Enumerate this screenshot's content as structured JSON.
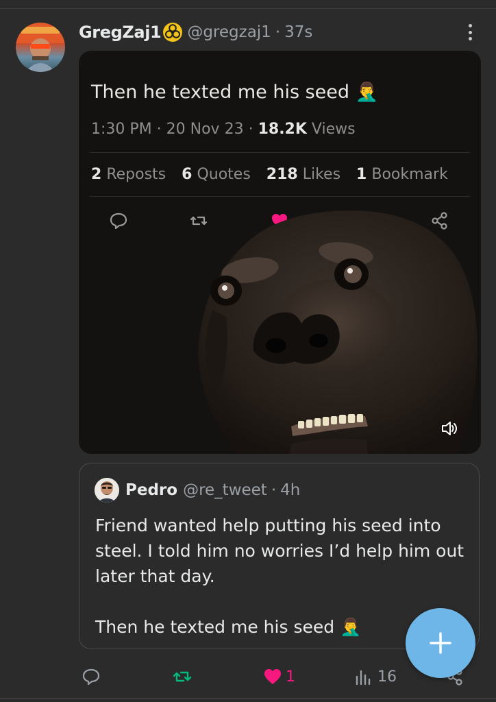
{
  "post": {
    "author": {
      "display_name": "GregZaj1",
      "handle": "@gregzaj1",
      "badge_icon": "biohazard-icon",
      "avatar_icon": "profile-avatar"
    },
    "separator": "·",
    "time": "37s",
    "more_icon": "more-vertical-icon"
  },
  "embedded_screenshot": {
    "text": "Then he texted me his seed",
    "emoji": "🤦‍♂️",
    "meta": {
      "time": "1:30 PM",
      "sep": "·",
      "date": "20 Nov 23",
      "views_count": "18.2K",
      "views_label": "Views"
    },
    "stats": [
      {
        "count": "2",
        "label": "Reposts"
      },
      {
        "count": "6",
        "label": "Quotes"
      },
      {
        "count": "218",
        "label": "Likes"
      },
      {
        "count": "1",
        "label": "Bookmark"
      }
    ],
    "icons": [
      "reply-icon",
      "repost-icon",
      "like-icon",
      "bookmark-icon",
      "share-icon"
    ],
    "overlay": "dog-image",
    "sound_icon": "volume-icon"
  },
  "quote": {
    "author": {
      "display_name": "Pedro",
      "handle": "@re_tweet"
    },
    "separator": "·",
    "time": "4h",
    "body_lines": [
      "Friend wanted help putting his seed into steel. I told him no worries I’d help him out later that day.",
      "Then he texted me his seed"
    ],
    "emoji": "🤦‍♂️"
  },
  "actions": {
    "reply": {
      "icon": "reply-icon",
      "count": ""
    },
    "repost": {
      "icon": "repost-icon",
      "count": ""
    },
    "like": {
      "icon": "heart-icon",
      "count": "1"
    },
    "views": {
      "icon": "analytics-icon",
      "count": "16"
    },
    "share": {
      "icon": "share-icon",
      "count": ""
    }
  },
  "fab": {
    "icon": "plus-icon"
  },
  "colors": {
    "background": "#2b2b2b",
    "secondary_text": "#9aa0a6",
    "repost_green": "#00ba7c",
    "like_pink": "#f91880",
    "fab_blue": "#6fb6e8"
  }
}
